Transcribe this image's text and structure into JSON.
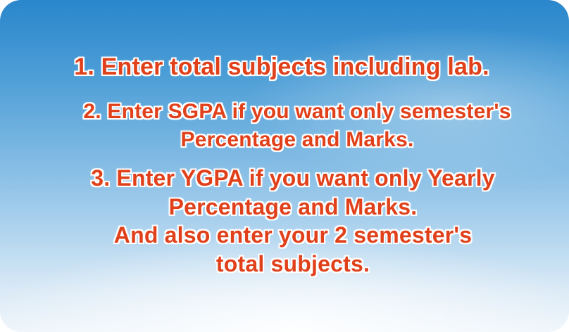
{
  "instructions": {
    "step1": "1. Enter total subjects including lab.",
    "step2_line1": "2. Enter SGPA if you want only semester's",
    "step2_line2": "Percentage and Marks.",
    "step3_line1": "3. Enter YGPA if you want only Yearly",
    "step3_line2": "Percentage and Marks.",
    "step3_line3": "And also enter your 2 semester's",
    "step3_line4": "total subjects."
  },
  "colors": {
    "text": "#e0401a",
    "outline": "#ffffff",
    "sky_top": "#2a86cc",
    "sky_bottom": "#eef5fb"
  }
}
